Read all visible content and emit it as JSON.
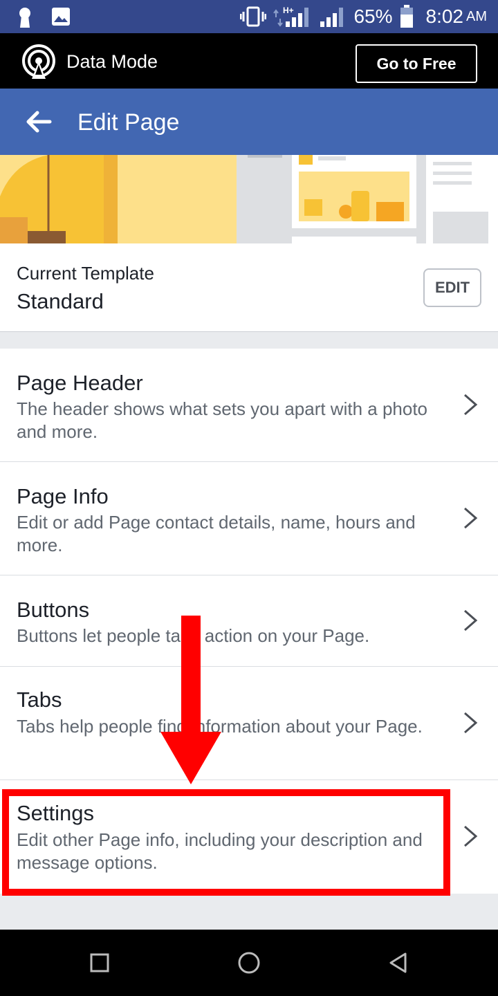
{
  "status_bar": {
    "network_type": "H+",
    "battery_percent": "65%",
    "time": "8:02",
    "ampm": "AM",
    "icons": [
      "keyhole-icon",
      "image-icon",
      "vibrate-icon",
      "signal-icon",
      "battery-icon"
    ]
  },
  "data_mode": {
    "label": "Data Mode",
    "go_free_label": "Go to Free"
  },
  "header": {
    "title": "Edit Page"
  },
  "template": {
    "label": "Current Template",
    "value": "Standard",
    "edit_label": "EDIT"
  },
  "menu": {
    "items": [
      {
        "title": "Page Header",
        "description": "The header shows what sets you apart with a photo and more."
      },
      {
        "title": "Page Info",
        "description": "Edit or add Page contact details, name, hours and more."
      },
      {
        "title": "Buttons",
        "description": "Buttons let people take action on your Page."
      },
      {
        "title": "Tabs",
        "description": "Tabs help people find information about your Page."
      },
      {
        "title": "Settings",
        "description": "Edit other Page info, including your description and message options."
      }
    ]
  },
  "colors": {
    "status_bar": "#34488c",
    "header": "#4267b2",
    "annotation": "#ff0000"
  }
}
